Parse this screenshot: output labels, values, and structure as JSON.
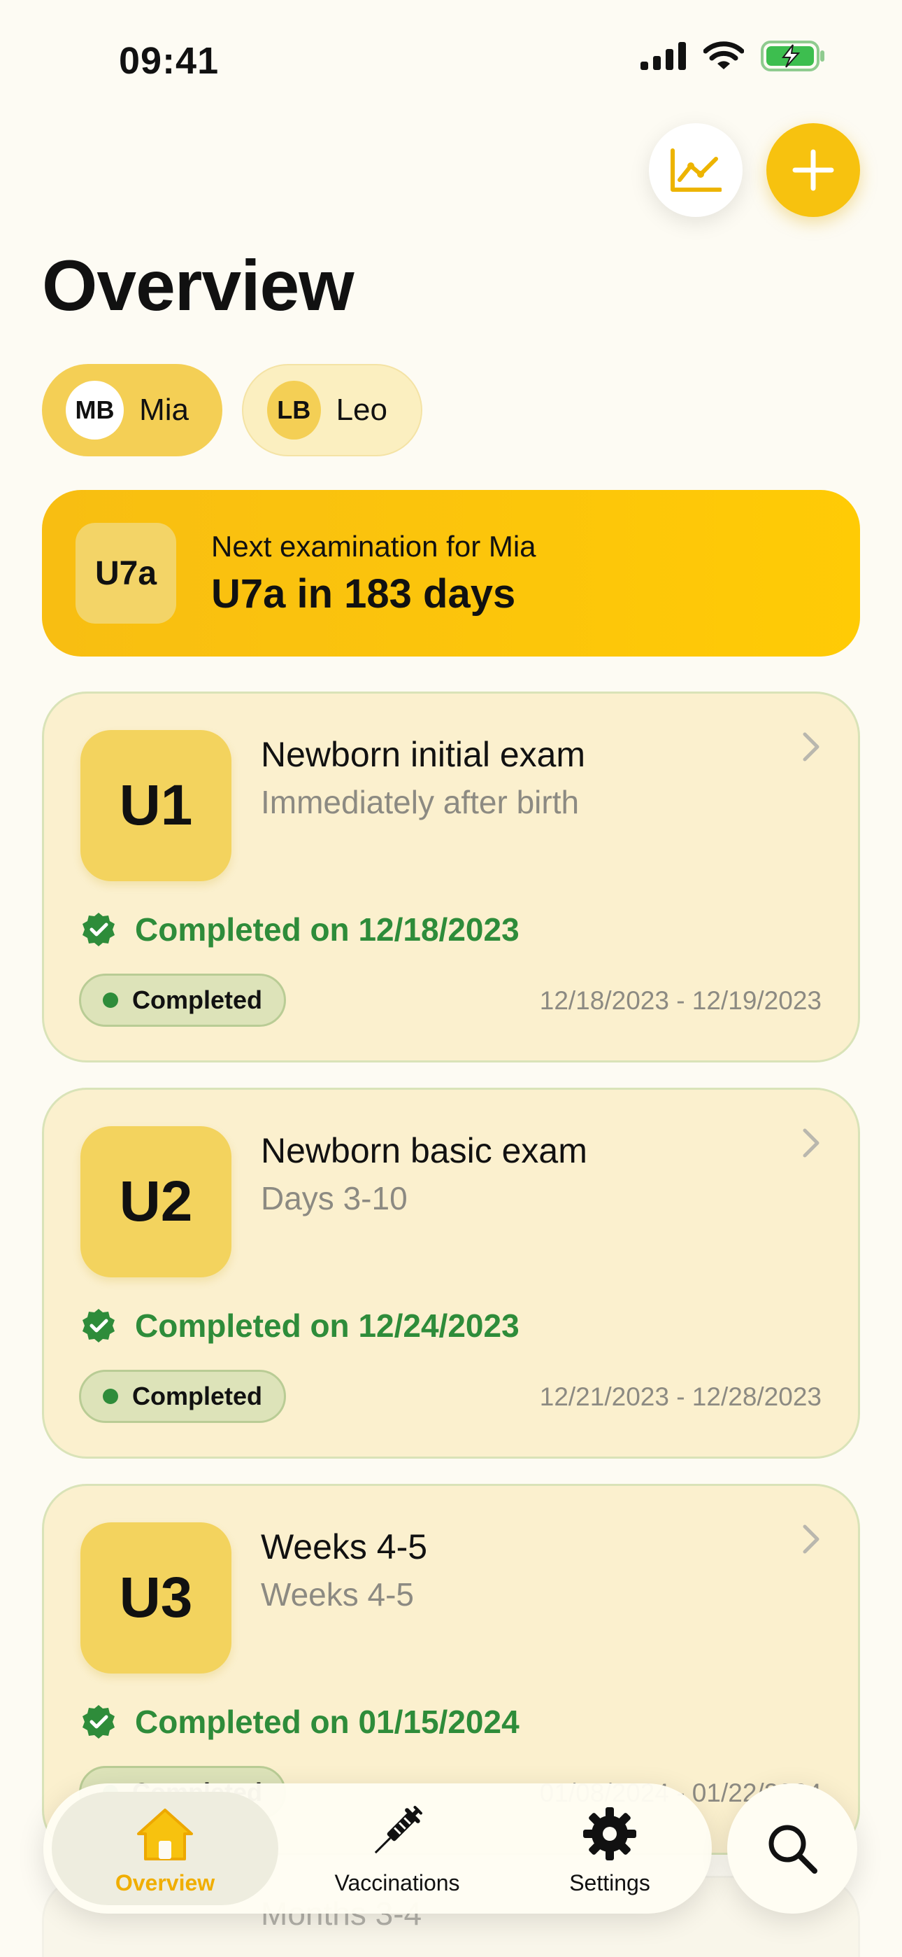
{
  "status_bar": {
    "time": "09:41"
  },
  "header": {
    "title": "Overview"
  },
  "children": [
    {
      "initials": "MB",
      "name": "Mia",
      "selected": true
    },
    {
      "initials": "LB",
      "name": "Leo",
      "selected": false
    }
  ],
  "next_exam": {
    "badge": "U7a",
    "label": "Next examination for Mia",
    "value": "U7a in 183 days"
  },
  "exams": [
    {
      "code": "U1",
      "title": "Newborn initial exam",
      "subtitle": "Immediately after birth",
      "completed_text": "Completed on 12/18/2023",
      "status": "Completed",
      "date_range": "12/18/2023 - 12/19/2023"
    },
    {
      "code": "U2",
      "title": "Newborn basic exam",
      "subtitle": "Days 3-10",
      "completed_text": "Completed on 12/24/2023",
      "status": "Completed",
      "date_range": "12/21/2023 - 12/28/2023"
    },
    {
      "code": "U3",
      "title": "Weeks 4-5",
      "subtitle": "Weeks 4-5",
      "completed_text": "Completed on 01/15/2024",
      "status": "Completed",
      "date_range": "01/08/2024 - 01/22/2024"
    },
    {
      "subtitle": "Months 3-4"
    }
  ],
  "tab_bar": {
    "tabs": [
      {
        "label": "Overview",
        "icon": "home-icon",
        "active": true
      },
      {
        "label": "Vaccinations",
        "icon": "syringe-icon",
        "active": false
      },
      {
        "label": "Settings",
        "icon": "gear-icon",
        "active": false
      }
    ]
  },
  "colors": {
    "accent": "#F7C20F",
    "success": "#2E8C3A",
    "card_bg": "#FBF0CE",
    "background": "#FDFBF3"
  }
}
